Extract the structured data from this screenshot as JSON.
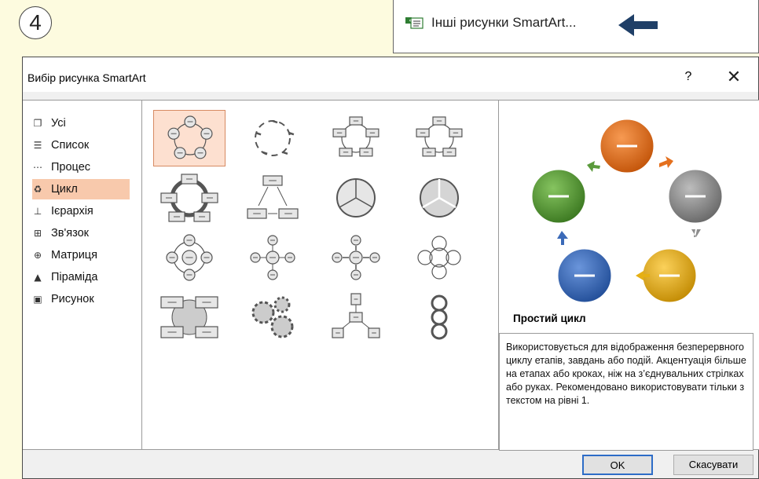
{
  "step_badge": "4",
  "menu": {
    "item_label": "Інші рисунки SmartArt...",
    "item_icon": "smartart-icon",
    "pointer_icon": "arrow-left-icon"
  },
  "dialog": {
    "title": "Вибір рисунка SmartArt",
    "help_label": "?",
    "close_label": "✕",
    "categories": [
      {
        "label": "Усі",
        "icon": "all-icon"
      },
      {
        "label": "Список",
        "icon": "list-icon"
      },
      {
        "label": "Процес",
        "icon": "process-icon"
      },
      {
        "label": "Цикл",
        "icon": "cycle-icon",
        "selected": true
      },
      {
        "label": "Ієрархія",
        "icon": "hierarchy-icon"
      },
      {
        "label": "Зв'язок",
        "icon": "relationship-icon"
      },
      {
        "label": "Матриця",
        "icon": "matrix-icon"
      },
      {
        "label": "Піраміда",
        "icon": "pyramid-icon"
      },
      {
        "label": "Рисунок",
        "icon": "picture-icon"
      }
    ],
    "layouts": [
      "basic-cycle",
      "text-cycle",
      "simple-cycle-boxes",
      "block-cycle",
      "continuous-cycle",
      "multidirectional-cycle",
      "segmented-cycle",
      "basic-pie",
      "radial-cycle",
      "basic-radial",
      "diverging-radial",
      "radial-venn",
      "cycle-matrix",
      "gear",
      "radial-cluster",
      "circle-arrow-process"
    ],
    "selected_layout": "basic-cycle",
    "preview": {
      "colors": [
        "#e4701e",
        "#8d8d8d",
        "#e6b014",
        "#3b6ab8",
        "#5a9a3b"
      ]
    },
    "layout_name": "Простий цикл",
    "description": "Використовується для відображення безперервного циклу етапів, завдань або подій. Акцентуація більше на етапах або кроках, ніж на з’єднувальних стрілках або руках. Рекомендовано використовувати тільки з текстом на рівні 1.",
    "ok_label": "OK",
    "cancel_label": "Скасувати"
  }
}
